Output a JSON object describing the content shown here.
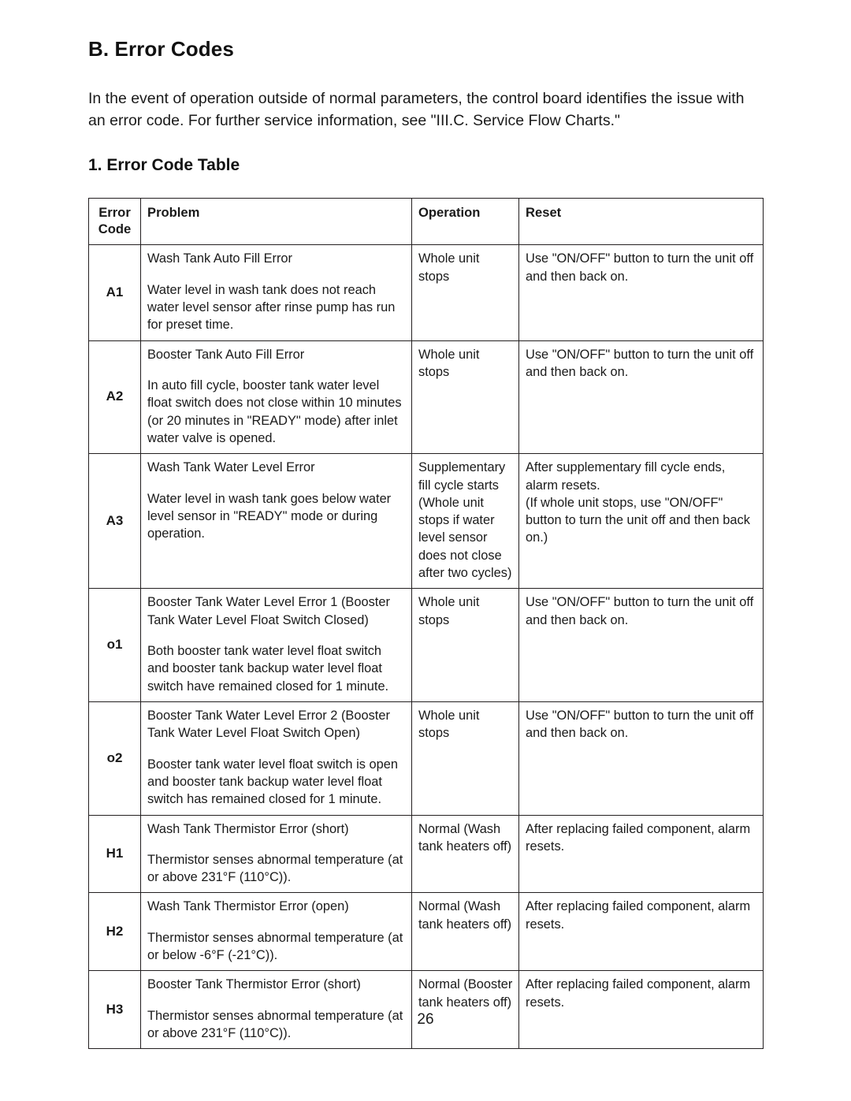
{
  "document": {
    "section_title": "B. Error Codes",
    "intro": "In the event of operation outside of normal parameters, the control board identifies the issue with an error code. For further service information, see \"III.C. Service Flow Charts.\"",
    "sub_title": "1. Error Code Table",
    "page_number": "26"
  },
  "table": {
    "headers": {
      "code_line1": "Error",
      "code_line2": "Code",
      "problem": "Problem",
      "operation": "Operation",
      "reset": "Reset"
    },
    "rows": [
      {
        "code": "A1",
        "problem_title": "Wash Tank Auto Fill Error",
        "problem_detail": "Water level in wash tank does not reach water level sensor after rinse pump has run for preset time.",
        "operation": "Whole unit stops",
        "reset": "Use \"ON/OFF\" button to turn the unit off and then back on."
      },
      {
        "code": "A2",
        "problem_title": "Booster Tank Auto Fill Error",
        "problem_detail": "In auto fill cycle, booster tank water level float switch does not close within 10 minutes (or 20 minutes in \"READY\" mode) after inlet water valve is opened.",
        "operation": "Whole unit stops",
        "reset": "Use \"ON/OFF\" button to turn the unit off and then back on."
      },
      {
        "code": "A3",
        "problem_title": "Wash Tank Water Level Error",
        "problem_detail": "Water level in wash tank goes below water level sensor in \"READY\" mode or during operation.",
        "operation": "Supplementary fill cycle starts (Whole unit stops if water level sensor does not close after two cycles)",
        "reset": "After supplementary fill cycle ends, alarm resets.\n(If whole unit stops, use \"ON/OFF\" button to turn the unit off and then back on.)"
      },
      {
        "code": "o1",
        "problem_title": "Booster Tank Water Level Error 1 (Booster Tank Water Level Float Switch Closed)",
        "problem_detail": "Both booster tank water level float switch and booster tank backup water level float switch have remained closed for 1 minute.",
        "operation": "Whole unit stops",
        "reset": "Use \"ON/OFF\" button to turn the unit off and then back on."
      },
      {
        "code": "o2",
        "problem_title": "Booster Tank Water Level Error 2 (Booster Tank Water Level Float Switch Open)",
        "problem_detail": "Booster tank water level float switch is open and booster tank backup water level float switch has remained closed for 1 minute.",
        "operation": "Whole unit stops",
        "reset": "Use \"ON/OFF\" button to turn the unit off and then back on."
      },
      {
        "code": "H1",
        "problem_title": "Wash Tank Thermistor Error (short)",
        "problem_detail": "Thermistor senses abnormal temperature (at or above 231°F (110°C)).",
        "operation": "Normal (Wash tank heaters off)",
        "reset": "After replacing failed component, alarm resets."
      },
      {
        "code": "H2",
        "problem_title": "Wash Tank Thermistor Error (open)",
        "problem_detail": "Thermistor senses abnormal temperature (at or below -6°F (-21°C)).",
        "operation": "Normal (Wash tank heaters off)",
        "reset": "After replacing failed component, alarm resets."
      },
      {
        "code": "H3",
        "problem_title": "Booster Tank Thermistor Error (short)",
        "problem_detail": "Thermistor senses abnormal temperature (at or above 231°F (110°C)).",
        "operation": "Normal (Booster tank heaters off)",
        "reset": "After replacing failed component, alarm resets."
      }
    ]
  }
}
